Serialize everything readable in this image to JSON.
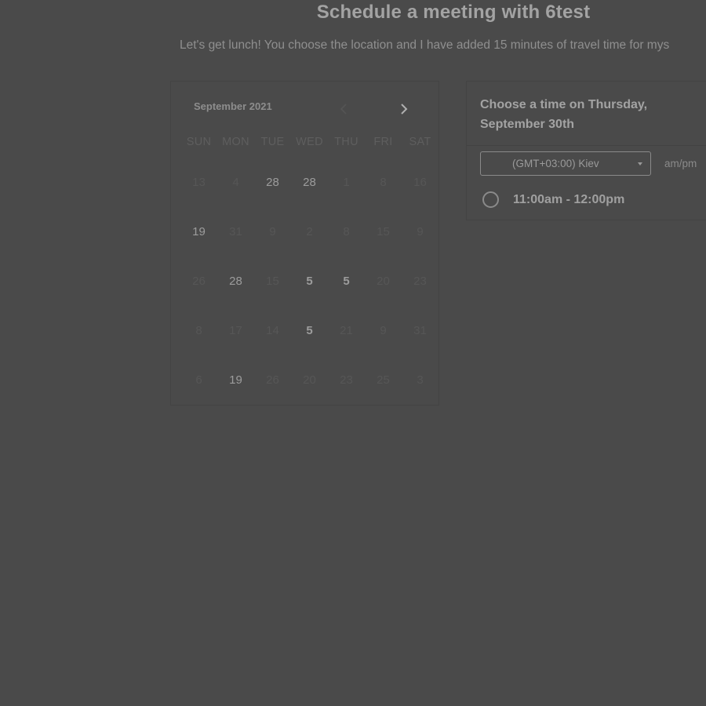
{
  "header": {
    "title": "Schedule a meeting with 6test",
    "subtitle": "Let's get lunch! You choose the location and I have added 15 minutes of travel time for mys"
  },
  "calendar": {
    "month_label": "September 2021",
    "prev_icon": "chevron-left-icon",
    "next_icon": "chevron-right-icon",
    "weekdays": [
      "SUN",
      "MON",
      "TUE",
      "WED",
      "THU",
      "FRI",
      "SAT"
    ],
    "weeks": [
      [
        {
          "label": "13",
          "available": false
        },
        {
          "label": "4",
          "available": false
        },
        {
          "label": "28",
          "available": true
        },
        {
          "label": "28",
          "available": true
        },
        {
          "label": "1",
          "available": false
        },
        {
          "label": "8",
          "available": false
        },
        {
          "label": "16",
          "available": false
        }
      ],
      [
        {
          "label": "19",
          "available": true
        },
        {
          "label": "31",
          "available": false
        },
        {
          "label": "9",
          "available": false
        },
        {
          "label": "2",
          "available": false
        },
        {
          "label": "8",
          "available": false
        },
        {
          "label": "15",
          "available": false
        },
        {
          "label": "9",
          "available": false
        }
      ],
      [
        {
          "label": "26",
          "available": false
        },
        {
          "label": "28",
          "available": true
        },
        {
          "label": "15",
          "available": false
        },
        {
          "label": "5",
          "available": true,
          "bold": true
        },
        {
          "label": "5",
          "available": true,
          "bold": true
        },
        {
          "label": "20",
          "available": false
        },
        {
          "label": "23",
          "available": false
        }
      ],
      [
        {
          "label": "8",
          "available": false
        },
        {
          "label": "17",
          "available": false
        },
        {
          "label": "14",
          "available": false
        },
        {
          "label": "5",
          "available": true,
          "bold": true
        },
        {
          "label": "21",
          "available": false
        },
        {
          "label": "9",
          "available": false
        },
        {
          "label": "31",
          "available": false
        }
      ],
      [
        {
          "label": "6",
          "available": false
        },
        {
          "label": "19",
          "available": true
        },
        {
          "label": "26",
          "available": false
        },
        {
          "label": "20",
          "available": false
        },
        {
          "label": "23",
          "available": false
        },
        {
          "label": "25",
          "available": false
        },
        {
          "label": "3",
          "available": false
        }
      ]
    ]
  },
  "time_panel": {
    "heading": "Choose a time on Thursday, September 30th",
    "timezone_value": "(GMT+03:00) Kiev",
    "timezone_icon": "caret-down-icon",
    "format_label": "am/pm",
    "slots": [
      {
        "label": "11:00am - 12:00pm"
      }
    ]
  },
  "colors": {
    "background": "#4a4a4a",
    "text_primary": "#a3a3a3",
    "text_dim": "#565656",
    "border": "#434343"
  }
}
